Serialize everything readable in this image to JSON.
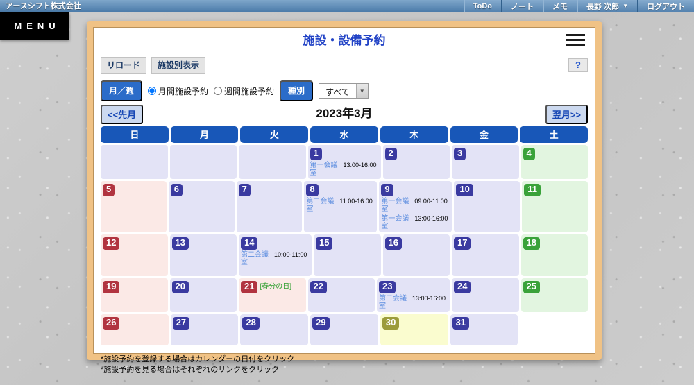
{
  "topbar": {
    "company": "アースシフト株式会社",
    "items": [
      "ToDo",
      "ノート",
      "メモ"
    ],
    "user": "長野 次郎",
    "user_caret": "▼",
    "logout": "ログアウト"
  },
  "menu_label": "MENU",
  "panel": {
    "title": "施設・設備予約",
    "toolbar": {
      "reload": "リロード",
      "by_facility": "施設別表示",
      "help": "?"
    },
    "filter": {
      "month_week": "月／週",
      "radio_month": "月間施設予約",
      "radio_week": "週間施設予約",
      "type_label": "種別",
      "type_value": "すべて",
      "select_arrow": "▼"
    },
    "nav": {
      "prev": "<<先月",
      "current": "2023年3月",
      "next": "翌月>>"
    },
    "weekdays": [
      "日",
      "月",
      "火",
      "水",
      "木",
      "金",
      "土"
    ],
    "notes": [
      "*施設予約を登録する場合はカレンダーの日付をクリック",
      "*施設予約を見る場合はそれぞれのリンクをクリック"
    ]
  },
  "calendar": {
    "weeks": [
      [
        {
          "type": "empty"
        },
        {
          "type": "empty"
        },
        {
          "type": "empty"
        },
        {
          "day": "1",
          "type": "weekday",
          "events": [
            {
              "room": "第一会議室",
              "time": "13:00-16:00"
            }
          ]
        },
        {
          "day": "2",
          "type": "weekday"
        },
        {
          "day": "3",
          "type": "weekday"
        },
        {
          "day": "4",
          "type": "sat"
        }
      ],
      [
        {
          "day": "5",
          "type": "sun"
        },
        {
          "day": "6",
          "type": "weekday"
        },
        {
          "day": "7",
          "type": "weekday"
        },
        {
          "day": "8",
          "type": "weekday",
          "events": [
            {
              "room": "第二会議室",
              "time": "11:00-16:00"
            }
          ]
        },
        {
          "day": "9",
          "type": "weekday",
          "events": [
            {
              "room": "第一会議室",
              "time": "09:00-11:00"
            },
            {
              "room": "第一会議室",
              "time": "13:00-16:00"
            }
          ]
        },
        {
          "day": "10",
          "type": "weekday"
        },
        {
          "day": "11",
          "type": "sat"
        }
      ],
      [
        {
          "day": "12",
          "type": "sun"
        },
        {
          "day": "13",
          "type": "weekday"
        },
        {
          "day": "14",
          "type": "weekday",
          "events": [
            {
              "room": "第二会議室",
              "time": "10:00-11:00"
            }
          ]
        },
        {
          "day": "15",
          "type": "weekday"
        },
        {
          "day": "16",
          "type": "weekday"
        },
        {
          "day": "17",
          "type": "weekday"
        },
        {
          "day": "18",
          "type": "sat"
        }
      ],
      [
        {
          "day": "19",
          "type": "sun"
        },
        {
          "day": "20",
          "type": "weekday"
        },
        {
          "day": "21",
          "type": "holiday",
          "holiday_label": "[春分の日]"
        },
        {
          "day": "22",
          "type": "weekday"
        },
        {
          "day": "23",
          "type": "weekday",
          "events": [
            {
              "room": "第二会議室",
              "time": "13:00-16:00"
            }
          ]
        },
        {
          "day": "24",
          "type": "weekday"
        },
        {
          "day": "25",
          "type": "sat"
        }
      ],
      [
        {
          "day": "26",
          "type": "sun"
        },
        {
          "day": "27",
          "type": "weekday"
        },
        {
          "day": "28",
          "type": "weekday"
        },
        {
          "day": "29",
          "type": "weekday"
        },
        {
          "day": "30",
          "type": "today"
        },
        {
          "day": "31",
          "type": "weekday"
        },
        {
          "type": "blank"
        }
      ]
    ]
  },
  "colors": {
    "accent_blue": "#2b6cc9",
    "title_blue": "#2243c6",
    "header_blue": "#1857b8",
    "frame_orange": "#f0c285",
    "cell_weekday": "#e3e3f6",
    "cell_sun": "#fbe9e6",
    "cell_sat": "#e2f5e0",
    "cell_today": "#fafccf",
    "badge_weekday": "#3a3aa0",
    "badge_sun": "#b13440",
    "badge_sat": "#3aa23a",
    "badge_today": "#9c9c3a",
    "link_blue": "#5f8fe0",
    "holiday_green": "#2f9e2f"
  }
}
